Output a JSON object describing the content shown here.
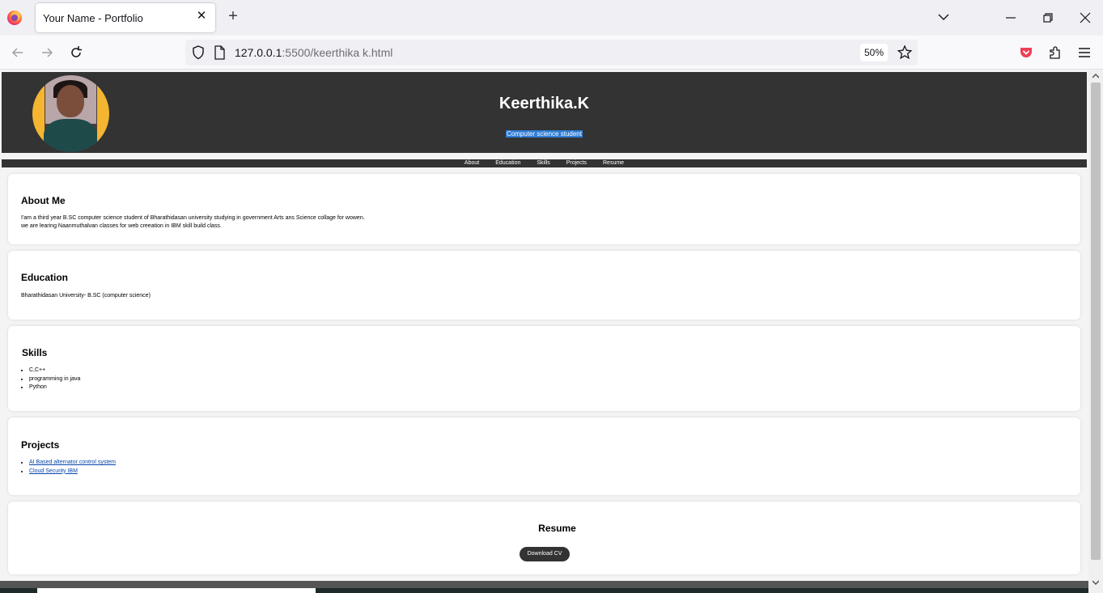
{
  "browser": {
    "tab_title": "Your Name - Portfolio",
    "url_host": "127.0.0.1",
    "url_rest": ":5500/keerthika k.html",
    "zoom": "50%",
    "new_tab_symbol": "+",
    "close_symbol": "✕"
  },
  "site": {
    "name": "Keerthika.K",
    "subtitle": "Computer science student",
    "nav": [
      "About",
      "Education",
      "Skills",
      "Projects",
      "Resume"
    ]
  },
  "sections": {
    "about": {
      "heading": "About Me",
      "text": "I'am a third year B.SC computer science student of Bharathidasan university studying in government Arts ans Science collage for wowen.\nwe are learing Naanmuthalvan classes for web creeation in IBM skill build class."
    },
    "education": {
      "heading": "Education",
      "text": "Bharathidasan University- B.SC (computer science)"
    },
    "skills": {
      "heading": "Skills",
      "items": [
        "C,C++",
        "programming in java",
        "Python"
      ]
    },
    "projects": {
      "heading": "Projects",
      "items": [
        "AI Based alternator control system",
        "Cloud Security IBM"
      ]
    },
    "resume": {
      "heading": "Resume",
      "button_label": "Download CV"
    }
  },
  "colors": {
    "header_bg": "#333333",
    "selection": "#2f7cd6",
    "link": "#0645ad",
    "avatar_ring": "#f4b530"
  },
  "icons": [
    "firefox-logo-icon",
    "back-arrow-icon",
    "forward-arrow-icon",
    "reload-icon",
    "shield-icon",
    "page-icon",
    "bookmark-star-icon",
    "pocket-icon",
    "extensions-icon",
    "menu-icon",
    "tab-list-chevron-icon",
    "minimize-icon",
    "restore-icon",
    "close-icon"
  ]
}
